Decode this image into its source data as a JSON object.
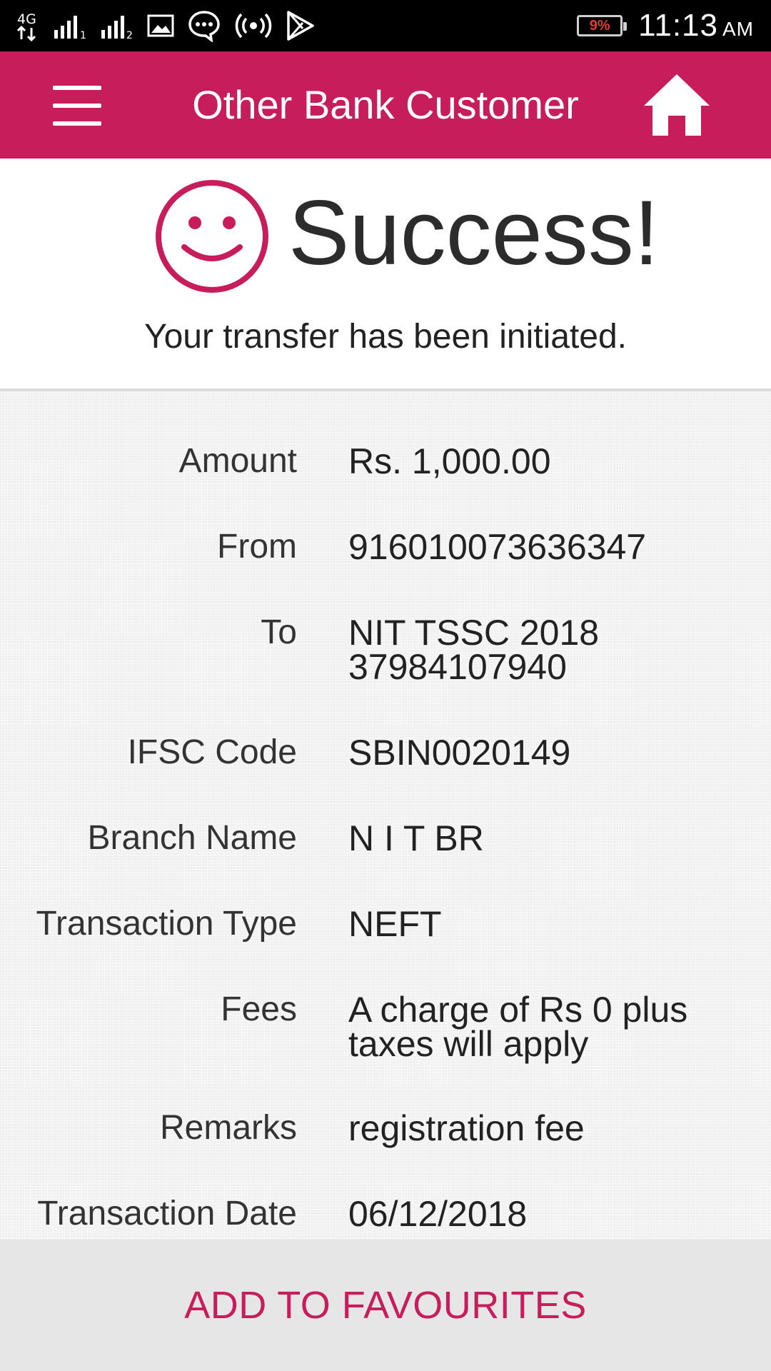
{
  "status_bar": {
    "network_label": "4G",
    "battery_percent": "9%",
    "time": "11:13",
    "ampm": "AM",
    "icons": [
      "network-4g-icon",
      "signal-sim1-icon",
      "signal-sim2-icon",
      "image-icon",
      "chat-icon",
      "hotspot-icon",
      "play-store-icon",
      "battery-icon"
    ]
  },
  "app_bar": {
    "title": "Other Bank Customer",
    "menu_icon": "hamburger-menu-icon",
    "home_icon": "home-icon"
  },
  "success": {
    "icon": "smiley-icon",
    "title": "Success!",
    "message": "Your transfer has been initiated."
  },
  "details": {
    "rows": [
      {
        "label": "Amount",
        "value": "Rs. 1,000.00"
      },
      {
        "label": "From",
        "value": "916010073636347"
      },
      {
        "label": "To",
        "value": "NIT TSSC 2018 37984107940"
      },
      {
        "label": "IFSC Code",
        "value": "SBIN0020149"
      },
      {
        "label": "Branch Name",
        "value": "N I T BR"
      },
      {
        "label": "Transaction Type",
        "value": "NEFT"
      },
      {
        "label": "Fees",
        "value": "A charge of Rs 0 plus taxes will apply"
      },
      {
        "label": "Remarks",
        "value": "registration fee"
      },
      {
        "label": "Transaction Date",
        "value": "06/12/2018"
      }
    ]
  },
  "footer": {
    "button_label": "ADD TO FAVOURITES"
  },
  "colors": {
    "brand": "#c81d5b",
    "status_bar_bg": "#000000",
    "footer_bg": "#e6e6e6",
    "battery_low": "#e53935"
  }
}
